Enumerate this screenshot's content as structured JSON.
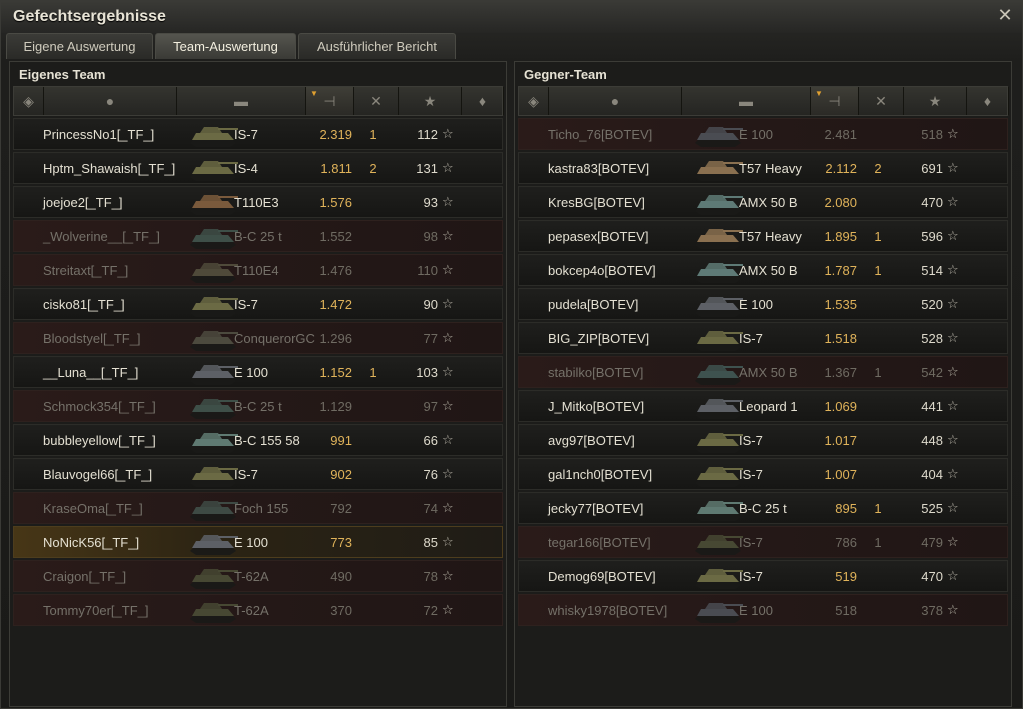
{
  "window": {
    "title": "Gefechtsergebnisse"
  },
  "tabs": [
    "Eigene Auswertung",
    "Team-Auswertung",
    "Ausführlicher Bericht"
  ],
  "left_team": {
    "title": "Eigenes Team",
    "players": [
      {
        "name": "PrincessNo1[_TF_]",
        "vehicle": "IS-7",
        "damage": "2.319",
        "kills": "1",
        "xp": "112",
        "status": "alive",
        "tank_color": "#6b6a44"
      },
      {
        "name": "Hptm_Shawaish[_TF_]",
        "vehicle": "IS-4",
        "damage": "1.811",
        "kills": "2",
        "xp": "131",
        "status": "alive",
        "tank_color": "#6b6a44"
      },
      {
        "name": "joejoe2[_TF_]",
        "vehicle": "T110E3",
        "damage": "1.576",
        "kills": "",
        "xp": "93",
        "status": "alive",
        "tank_color": "#7a5a3c"
      },
      {
        "name": "_Wolverine__[_TF_]",
        "vehicle": "B-C 25 t",
        "damage": "1.552",
        "kills": "",
        "xp": "98",
        "status": "dead",
        "tank_color": "#3e4f48"
      },
      {
        "name": "Streitaxt[_TF_]",
        "vehicle": "T110E4",
        "damage": "1.476",
        "kills": "",
        "xp": "110",
        "status": "dead",
        "tank_color": "#4f4a3a"
      },
      {
        "name": "cisko81[_TF_]",
        "vehicle": "IS-7",
        "damage": "1.472",
        "kills": "",
        "xp": "90",
        "status": "alive",
        "tank_color": "#6b6a44"
      },
      {
        "name": "Bloodstyel[_TF_]",
        "vehicle": "ConquerorGC",
        "damage": "1.296",
        "kills": "",
        "xp": "77",
        "status": "dead",
        "tank_color": "#4c4a3e"
      },
      {
        "name": "__Luna__[_TF_]",
        "vehicle": "E 100",
        "damage": "1.152",
        "kills": "1",
        "xp": "103",
        "status": "alive",
        "tank_color": "#5d6066"
      },
      {
        "name": "Schmock354[_TF_]",
        "vehicle": "B-C 25 t",
        "damage": "1.129",
        "kills": "",
        "xp": "97",
        "status": "dead",
        "tank_color": "#3e4f48"
      },
      {
        "name": "bubbleyellow[_TF_]",
        "vehicle": "B-C 155 58",
        "damage": "991",
        "kills": "",
        "xp": "66",
        "status": "alive",
        "tank_color": "#5f7a72"
      },
      {
        "name": "Blauvogel66[_TF_]",
        "vehicle": "IS-7",
        "damage": "902",
        "kills": "",
        "xp": "76",
        "status": "alive",
        "tank_color": "#6b6a44"
      },
      {
        "name": "KraseOma[_TF_]",
        "vehicle": "Foch 155",
        "damage": "792",
        "kills": "",
        "xp": "74",
        "status": "dead",
        "tank_color": "#3e4a44"
      },
      {
        "name": "NoNicK56[_TF_]",
        "vehicle": "E 100",
        "damage": "773",
        "kills": "",
        "xp": "85",
        "status": "self",
        "tank_color": "#5d6066"
      },
      {
        "name": "Craigon[_TF_]",
        "vehicle": "T-62A",
        "damage": "490",
        "kills": "",
        "xp": "78",
        "status": "dead",
        "tank_color": "#474833"
      },
      {
        "name": "Tommy70er[_TF_]",
        "vehicle": "T-62A",
        "damage": "370",
        "kills": "",
        "xp": "72",
        "status": "dead",
        "tank_color": "#474833"
      }
    ]
  },
  "right_team": {
    "title": "Gegner-Team",
    "players": [
      {
        "name": "Ticho_76[BOTEV]",
        "vehicle": "E 100",
        "damage": "2.481",
        "kills": "",
        "xp": "518",
        "status": "dead",
        "tank_color": "#4a4c52"
      },
      {
        "name": "kastra83[BOTEV]",
        "vehicle": "T57 Heavy",
        "damage": "2.112",
        "kills": "2",
        "xp": "691",
        "status": "alive",
        "tank_color": "#8a7050"
      },
      {
        "name": "KresBG[BOTEV]",
        "vehicle": "AMX 50 B",
        "damage": "2.080",
        "kills": "",
        "xp": "470",
        "status": "alive",
        "tank_color": "#5e7a76"
      },
      {
        "name": "pepasex[BOTEV]",
        "vehicle": "T57 Heavy",
        "damage": "1.895",
        "kills": "1",
        "xp": "596",
        "status": "alive",
        "tank_color": "#8a7050"
      },
      {
        "name": "bokcep4o[BOTEV]",
        "vehicle": "AMX 50 B",
        "damage": "1.787",
        "kills": "1",
        "xp": "514",
        "status": "alive",
        "tank_color": "#5e7a76"
      },
      {
        "name": "pudela[BOTEV]",
        "vehicle": "E 100",
        "damage": "1.535",
        "kills": "",
        "xp": "520",
        "status": "alive",
        "tank_color": "#5d6066"
      },
      {
        "name": "BIG_ZIP[BOTEV]",
        "vehicle": "IS-7",
        "damage": "1.518",
        "kills": "",
        "xp": "528",
        "status": "alive",
        "tank_color": "#6b6a44"
      },
      {
        "name": "stabilko[BOTEV]",
        "vehicle": "AMX 50 B",
        "damage": "1.367",
        "kills": "1",
        "xp": "542",
        "status": "dead",
        "tank_color": "#3e524f"
      },
      {
        "name": "J_Mitko[BOTEV]",
        "vehicle": "Leopard 1",
        "damage": "1.069",
        "kills": "",
        "xp": "441",
        "status": "alive",
        "tank_color": "#5d6066"
      },
      {
        "name": "avg97[BOTEV]",
        "vehicle": "IS-7",
        "damage": "1.017",
        "kills": "",
        "xp": "448",
        "status": "alive",
        "tank_color": "#6b6a44"
      },
      {
        "name": "gal1nch0[BOTEV]",
        "vehicle": "IS-7",
        "damage": "1.007",
        "kills": "",
        "xp": "404",
        "status": "alive",
        "tank_color": "#6b6a44"
      },
      {
        "name": "jecky77[BOTEV]",
        "vehicle": "B-C 25 t",
        "damage": "895",
        "kills": "1",
        "xp": "525",
        "status": "alive",
        "tank_color": "#5f7a72"
      },
      {
        "name": "tegar166[BOTEV]",
        "vehicle": "IS-7",
        "damage": "786",
        "kills": "1",
        "xp": "479",
        "status": "dead",
        "tank_color": "#474833"
      },
      {
        "name": "Demog69[BOTEV]",
        "vehicle": "IS-7",
        "damage": "519",
        "kills": "",
        "xp": "470",
        "status": "alive",
        "tank_color": "#6b6a44"
      },
      {
        "name": "whisky1978[BOTEV]",
        "vehicle": "E 100",
        "damage": "518",
        "kills": "",
        "xp": "378",
        "status": "dead",
        "tank_color": "#4a4c52"
      }
    ]
  },
  "columns": [
    {
      "icon": "squad-icon",
      "glyph": "◈"
    },
    {
      "icon": "player-icon",
      "glyph": "●"
    },
    {
      "icon": "tank-icon",
      "glyph": "▬"
    },
    {
      "icon": "damage-icon",
      "glyph": "⊣"
    },
    {
      "icon": "kills-icon",
      "glyph": "✕"
    },
    {
      "icon": "xp-star-icon",
      "glyph": "★"
    },
    {
      "icon": "medal-icon",
      "glyph": "♦"
    }
  ],
  "colors": {
    "damage_text": "#e0b35a",
    "self_row": "#473616",
    "dead_row": "#2a1b19"
  }
}
